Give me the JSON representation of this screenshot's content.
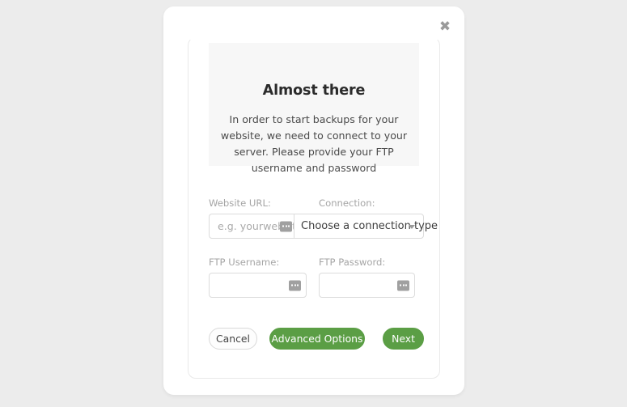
{
  "modal": {
    "close_icon": "close-icon",
    "close_glyph": "✖",
    "intro": {
      "title": "Almost there",
      "body": "In order to start backups for your website, we need to connect to your server. Please provide your FTP username and password"
    },
    "form": {
      "website_url": {
        "label": "Website URL:",
        "placeholder": "e.g. yourwebsite.com",
        "value": ""
      },
      "connection": {
        "label": "Connection:",
        "selected": "Choose a connection type"
      },
      "ftp_username": {
        "label": "FTP Username:",
        "placeholder": "",
        "value": ""
      },
      "ftp_password": {
        "label": "FTP Password:",
        "placeholder": "",
        "value": ""
      }
    },
    "buttons": {
      "cancel": "Cancel",
      "advanced": "Advanced Options",
      "next": "Next"
    }
  },
  "colors": {
    "accent_green": "#5b9e45",
    "page_background": "#ececec",
    "panel_background": "#f7f7f7"
  }
}
